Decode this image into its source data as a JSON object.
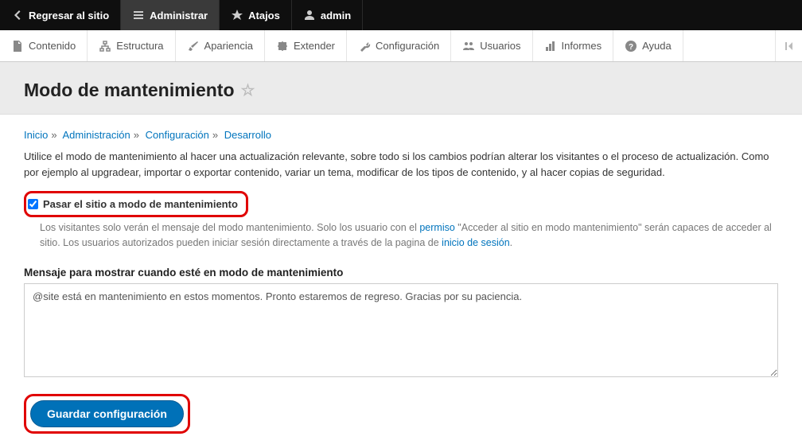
{
  "toolbar": {
    "back": "Regresar al sitio",
    "admin": "Administrar",
    "shortcuts": "Atajos",
    "user": "admin"
  },
  "adminMenu": {
    "content": "Contenido",
    "structure": "Estructura",
    "appearance": "Apariencia",
    "extend": "Extender",
    "config": "Configuración",
    "users": "Usuarios",
    "reports": "Informes",
    "help": "Ayuda"
  },
  "page": {
    "title": "Modo de mantenimiento"
  },
  "breadcrumb": {
    "home": "Inicio",
    "admin": "Administración",
    "config": "Configuración",
    "dev": "Desarrollo"
  },
  "description": "Utilice el modo de mantenimiento al hacer una actualización relevante, sobre todo si los cambios podrían alterar los visitantes o el proceso de actualización. Como por ejemplo al upgradear, importar o exportar contenido, variar un tema, modificar de los tipos de contenido, y al hacer copias de seguridad.",
  "form": {
    "checkbox_label": "Pasar el sitio a modo de mantenimiento",
    "help_pre": "Los visitantes solo verán el mensaje del modo mantenimiento. Solo los usuario con el ",
    "help_perm_link": "permiso",
    "help_mid": " \"Acceder al sitio en modo mantenimiento\" serán capaces de acceder al sitio. Los usuarios autorizados pueden iniciar sesión directamente a través de la pagina de ",
    "help_login_link": "inicio de sesión",
    "help_end": ".",
    "msg_label": "Mensaje para mostrar cuando esté en modo de mantenimiento",
    "msg_value": "@site está en mantenimiento en estos momentos. Pronto estaremos de regreso. Gracias por su paciencia.",
    "submit": "Guardar configuración"
  }
}
